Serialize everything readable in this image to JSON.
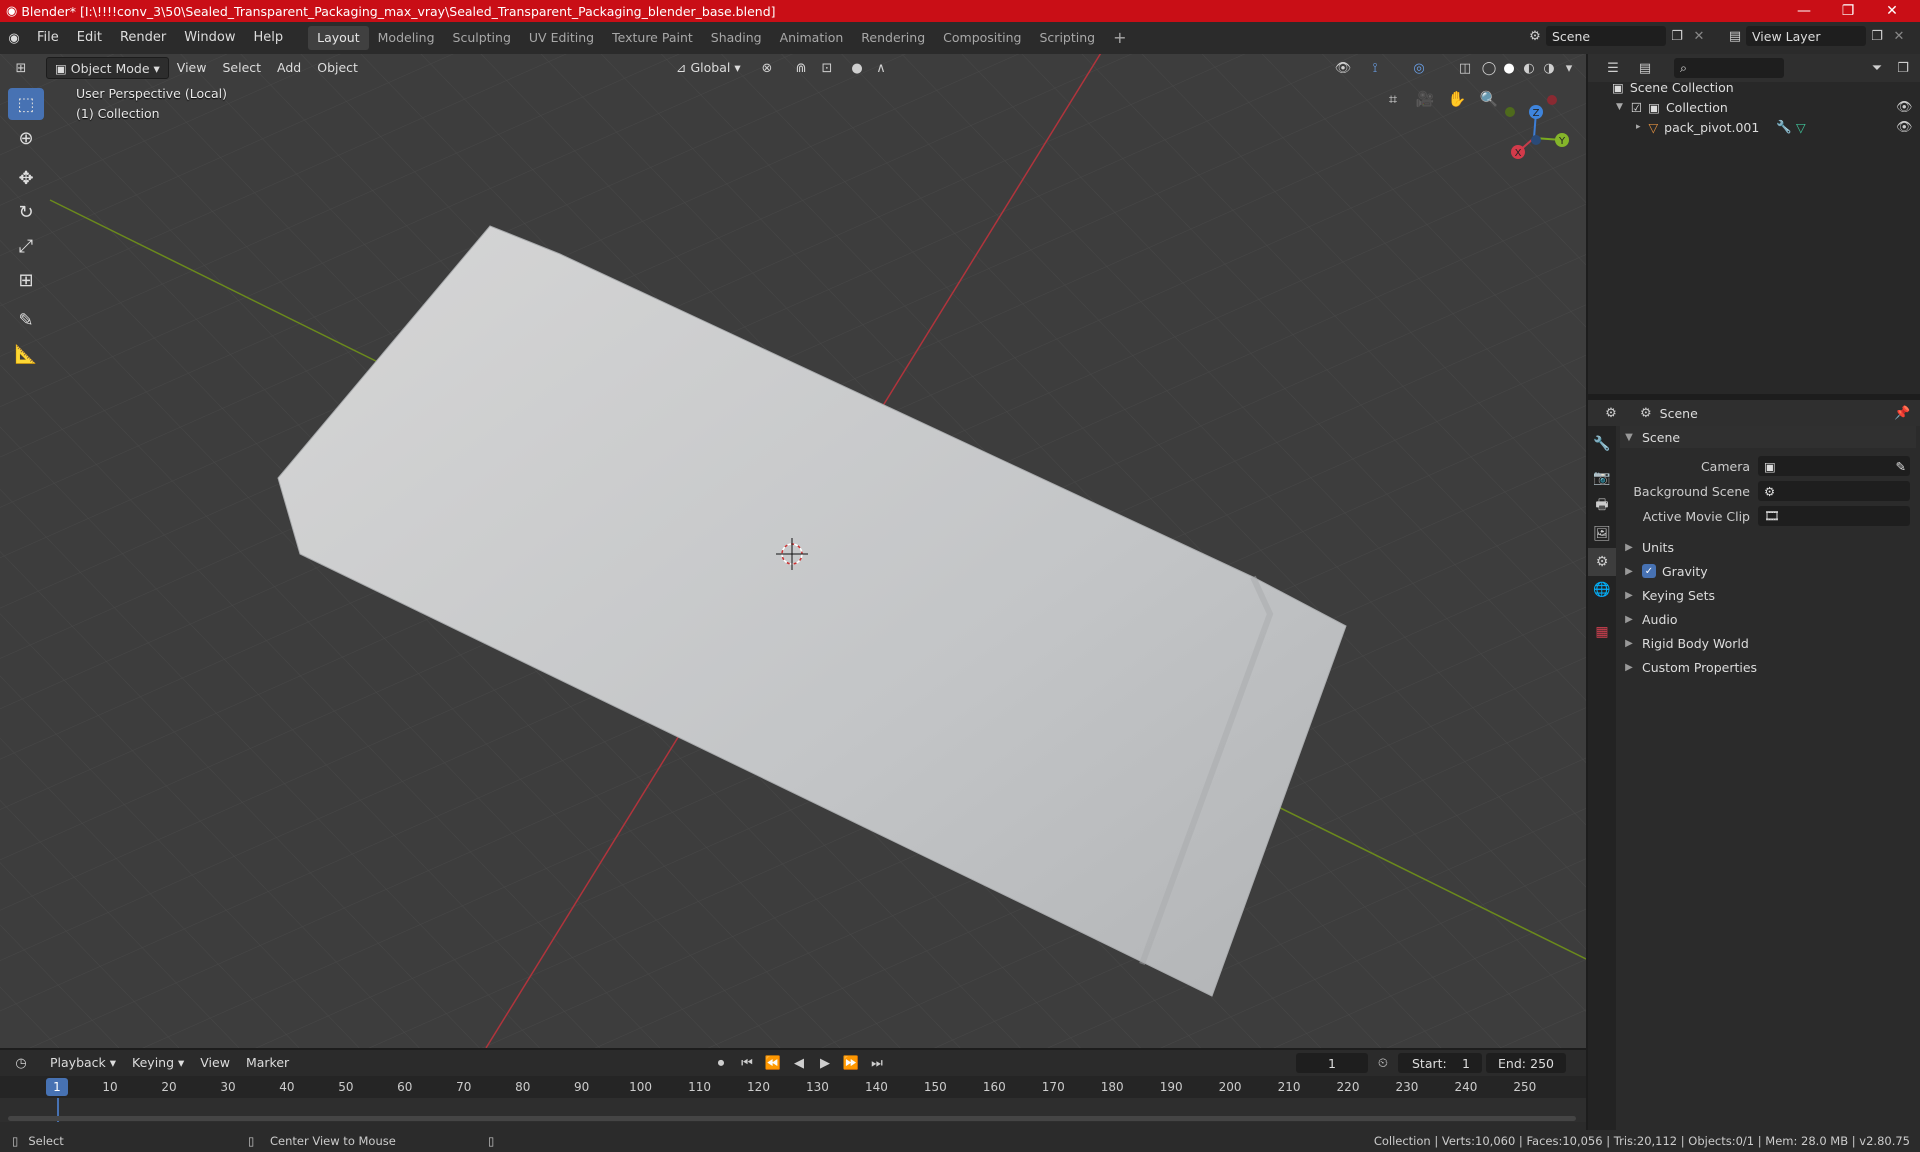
{
  "title": "Blender* [I:\\!!!!conv_3\\50\\Sealed_Transparent_Packaging_max_vray\\Sealed_Transparent_Packaging_blender_base.blend]",
  "menus": [
    "File",
    "Edit",
    "Render",
    "Window",
    "Help"
  ],
  "workspaces": [
    "Layout",
    "Modeling",
    "Sculpting",
    "UV Editing",
    "Texture Paint",
    "Shading",
    "Animation",
    "Rendering",
    "Compositing",
    "Scripting"
  ],
  "active_workspace": "Layout",
  "scene_name": "Scene",
  "view_layer": "View Layer",
  "viewport": {
    "mode": "Object Mode",
    "menus": [
      "View",
      "Select",
      "Add",
      "Object"
    ],
    "orientation": "Global",
    "info_line1": "User Perspective (Local)",
    "info_line2": "(1) Collection",
    "gizmo": {
      "x": "X",
      "y": "Y",
      "z": "Z"
    }
  },
  "outliner": {
    "search_placeholder": "",
    "root": "Scene Collection",
    "collection": "Collection",
    "object": "pack_pivot.001"
  },
  "properties": {
    "header": "Scene",
    "panel": "Scene",
    "rows": [
      {
        "label": "Camera",
        "value": ""
      },
      {
        "label": "Background Scene",
        "value": ""
      },
      {
        "label": "Active Movie Clip",
        "value": ""
      }
    ],
    "sections": [
      "Units",
      "Gravity",
      "Keying Sets",
      "Audio",
      "Rigid Body World",
      "Custom Properties"
    ]
  },
  "timeline": {
    "menus": [
      "Playback",
      "Keying",
      "View",
      "Marker"
    ],
    "current_frame": "1",
    "start_label": "Start:",
    "start": "1",
    "end_label": "End:",
    "end": "250",
    "ticks": [
      "1",
      "10",
      "20",
      "30",
      "40",
      "50",
      "60",
      "70",
      "80",
      "90",
      "100",
      "110",
      "120",
      "130",
      "140",
      "150",
      "160",
      "170",
      "180",
      "190",
      "200",
      "210",
      "220",
      "230",
      "240",
      "250"
    ]
  },
  "status": {
    "left": "Select",
    "mid": "Center View to Mouse",
    "right": "Collection | Verts:10,060 | Faces:10,056 | Tris:20,112 | Objects:0/1 | Mem: 28.0 MB | v2.80.75"
  },
  "colors": {
    "accent": "#4772b3",
    "titlebar": "#c90e16",
    "x_axis": "#c0393f",
    "y_axis": "#7a9e1c"
  }
}
